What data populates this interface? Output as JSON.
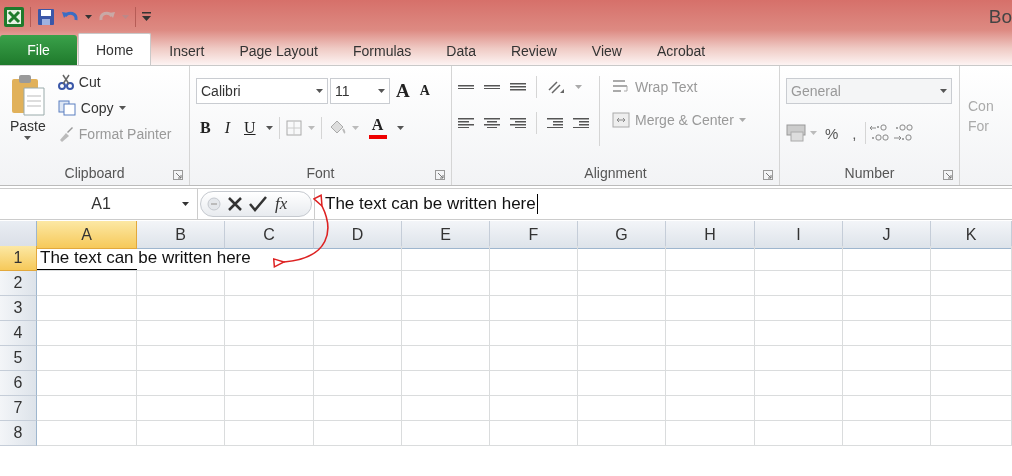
{
  "window": {
    "title": "Bo"
  },
  "tabs": [
    {
      "label": "File",
      "kind": "file",
      "selected": false
    },
    {
      "label": "Home",
      "kind": "tab",
      "selected": true
    },
    {
      "label": "Insert",
      "kind": "tab",
      "selected": false
    },
    {
      "label": "Page Layout",
      "kind": "tab",
      "selected": false
    },
    {
      "label": "Formulas",
      "kind": "tab",
      "selected": false
    },
    {
      "label": "Data",
      "kind": "tab",
      "selected": false
    },
    {
      "label": "Review",
      "kind": "tab",
      "selected": false
    },
    {
      "label": "View",
      "kind": "tab",
      "selected": false
    },
    {
      "label": "Acrobat",
      "kind": "tab",
      "selected": false
    }
  ],
  "clipboard": {
    "label": "Clipboard",
    "paste": "Paste",
    "cut": {
      "label": "Cut",
      "disabled": false
    },
    "copy": {
      "label": "Copy",
      "disabled": false
    },
    "format_painter": {
      "label": "Format Painter",
      "disabled": true
    }
  },
  "font": {
    "label": "Font",
    "font_name": "Calibri",
    "font_size": "11",
    "buttons": [
      {
        "kind": "grow",
        "glyph": "A"
      },
      {
        "kind": "shrink",
        "glyph": "A"
      },
      {
        "kind": "bold",
        "glyph": "B"
      },
      {
        "kind": "italic",
        "glyph": "I"
      },
      {
        "kind": "underline",
        "glyph": "U"
      },
      {
        "kind": "color",
        "glyph": "A"
      }
    ]
  },
  "alignment": {
    "label": "Alignment",
    "wrap_text": {
      "label": "Wrap Text",
      "disabled": true
    },
    "merge": {
      "label": "Merge & Center",
      "disabled": true
    }
  },
  "number": {
    "label": "Number",
    "format": {
      "value": "General",
      "disabled": true
    },
    "percent": "%",
    "comma": ","
  },
  "styles": {
    "label_lines": [
      "Con",
      "For"
    ]
  },
  "formula_bar": {
    "name_box": "A1",
    "function_button": "fx",
    "formula": "The text can be written here"
  },
  "sheet": {
    "columns": [
      {
        "label": "A",
        "selected": true
      },
      {
        "label": "B",
        "selected": false
      },
      {
        "label": "C",
        "selected": false
      },
      {
        "label": "D",
        "selected": false
      },
      {
        "label": "E",
        "selected": false
      },
      {
        "label": "F",
        "selected": false
      },
      {
        "label": "G",
        "selected": false
      },
      {
        "label": "H",
        "selected": false
      },
      {
        "label": "I",
        "selected": false
      },
      {
        "label": "J",
        "selected": false
      },
      {
        "label": "K",
        "selected": false
      }
    ],
    "rows": [
      {
        "header": "1",
        "selected": true,
        "cells": [
          "The text can be written here"
        ]
      },
      {
        "header": "2",
        "selected": false
      },
      {
        "header": "3",
        "selected": false
      },
      {
        "header": "4",
        "selected": false
      },
      {
        "header": "5",
        "selected": false
      },
      {
        "header": "6",
        "selected": false
      },
      {
        "header": "7",
        "selected": false
      },
      {
        "header": "8",
        "selected": false
      }
    ]
  }
}
